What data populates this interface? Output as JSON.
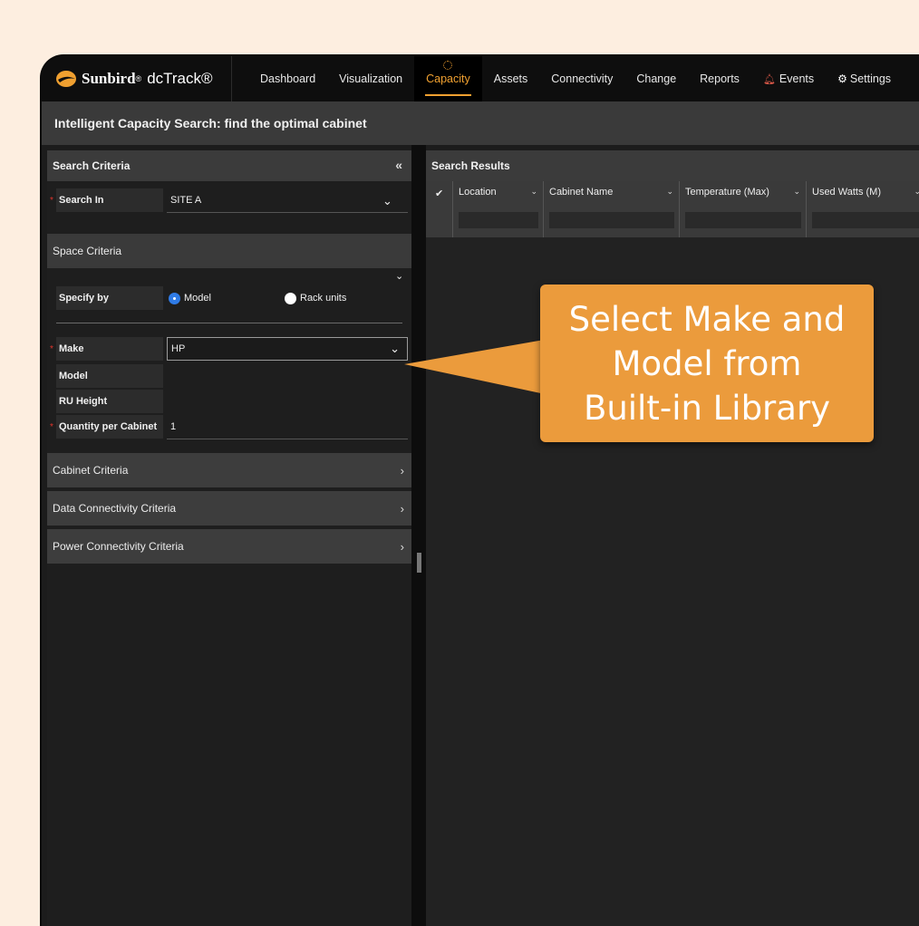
{
  "app": {
    "brand_name": "Sunbird",
    "brand_reg": "®",
    "product": "dcTrack®"
  },
  "nav": {
    "items": [
      {
        "label": "Dashboard"
      },
      {
        "label": "Visualization"
      },
      {
        "label": "Capacity"
      },
      {
        "label": "Assets"
      },
      {
        "label": "Connectivity"
      },
      {
        "label": "Change"
      },
      {
        "label": "Reports"
      },
      {
        "label": "Events"
      },
      {
        "label": "Settings"
      }
    ],
    "active": "Capacity",
    "accent": "#f0a030"
  },
  "page": {
    "title": "Intelligent Capacity Search: find the optimal cabinet"
  },
  "search_criteria": {
    "header": "Search Criteria",
    "search_in_label": "Search In",
    "search_in_value": "SITE A",
    "space_criteria": "Space Criteria",
    "specify_by_label": "Specify by",
    "specify_options": [
      "Model",
      "Rack units"
    ],
    "specify_selected": "Model",
    "make_label": "Make",
    "make_value": "HP",
    "model_label": "Model",
    "ru_height_label": "RU Height",
    "quantity_label": "Quantity per Cabinet",
    "quantity_value": "1",
    "sections": [
      {
        "label": "Cabinet Criteria"
      },
      {
        "label": "Data Connectivity Criteria"
      },
      {
        "label": "Power Connectivity Criteria"
      }
    ]
  },
  "search_results": {
    "header": "Search Results",
    "columns": [
      "Location",
      "Cabinet Name",
      "Temperature (Max)",
      "Used Watts (M)"
    ]
  },
  "callout": {
    "lines": [
      "Select Make and",
      "Model from",
      "Built-in Library"
    ],
    "color": "#eb9b3c"
  }
}
